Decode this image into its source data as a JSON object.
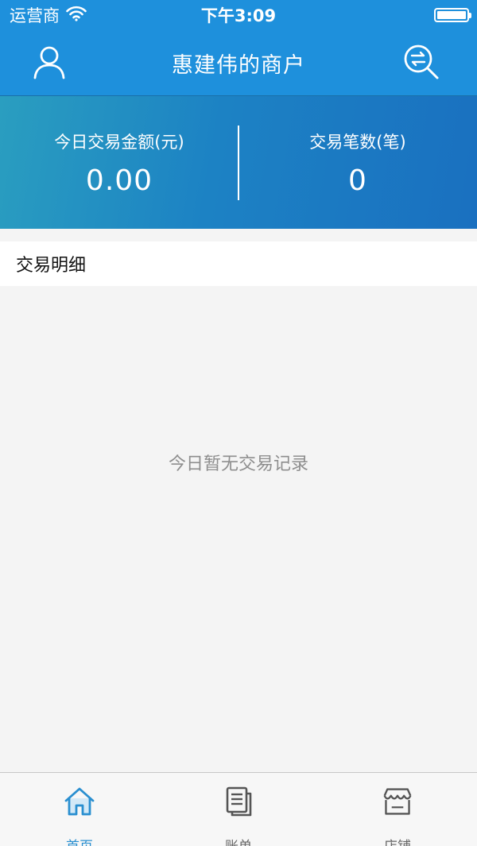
{
  "status_bar": {
    "carrier": "运营商",
    "time": "下午3:09"
  },
  "nav": {
    "title": "惠建伟的商户",
    "left_icon": "user-icon",
    "right_icon": "switch-search-icon"
  },
  "summary": {
    "amount_label": "今日交易金额(元)",
    "amount_value": "0.00",
    "count_label": "交易笔数(笔)",
    "count_value": "0"
  },
  "details": {
    "title": "交易明细",
    "empty_text": "今日暂无交易记录"
  },
  "tabs": [
    {
      "label": "首页",
      "icon": "home-icon",
      "active": true
    },
    {
      "label": "账单",
      "icon": "bill-icon",
      "active": false
    },
    {
      "label": "店铺",
      "icon": "store-icon",
      "active": false
    }
  ],
  "colors": {
    "primary": "#1e90dc",
    "active_tab": "#2a8fd0",
    "inactive_tab": "#666666"
  }
}
